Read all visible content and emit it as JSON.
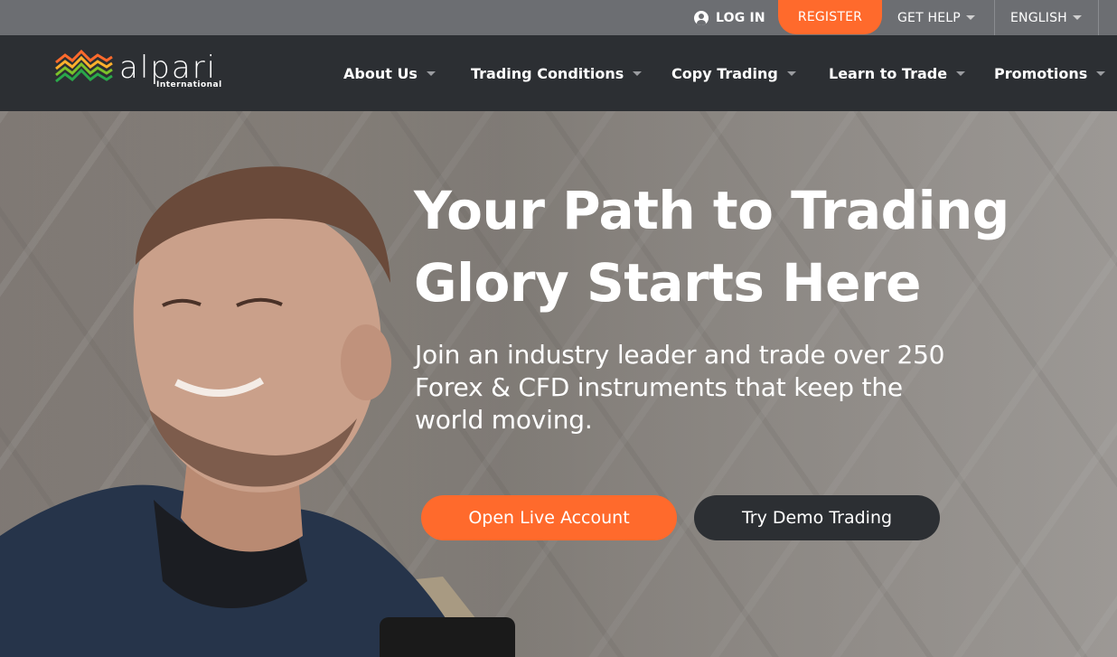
{
  "topbar": {
    "login_label": "LOG IN",
    "register_label": "REGISTER",
    "help_label": "GET HELP",
    "language_label": "ENGLISH"
  },
  "brand": {
    "name": "alpari",
    "tagline": "International",
    "accent_color": "#ff6a2c",
    "nav_bg": "#2c2f33"
  },
  "nav": {
    "items": [
      {
        "label": "About Us"
      },
      {
        "label": "Trading Conditions"
      },
      {
        "label": "Copy Trading"
      },
      {
        "label": "Learn to Trade"
      },
      {
        "label": "Promotions"
      }
    ]
  },
  "hero": {
    "headline_line1": "Your Path to Trading",
    "headline_line2": "Glory Starts Here",
    "subline_line1": "Join an industry leader and trade over 250",
    "subline_line2": "Forex & CFD instruments that keep the",
    "subline_line3": "world moving.",
    "primary_button": "Open Live Account",
    "secondary_button": "Try Demo Trading"
  }
}
